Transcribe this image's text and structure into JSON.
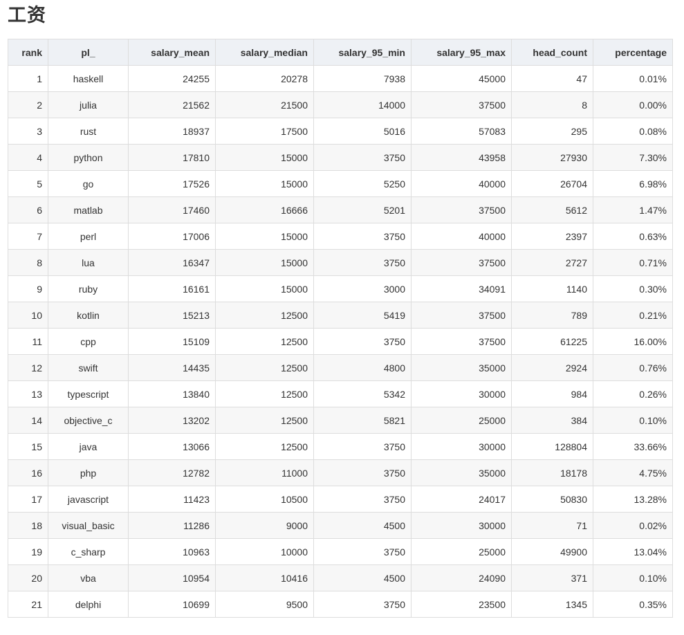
{
  "page": {
    "title": "工资"
  },
  "table": {
    "columns": [
      "rank",
      "pl_",
      "salary_mean",
      "salary_median",
      "salary_95_min",
      "salary_95_max",
      "head_count",
      "percentage"
    ],
    "rows": [
      [
        "1",
        "haskell",
        "24255",
        "20278",
        "7938",
        "45000",
        "47",
        "0.01%"
      ],
      [
        "2",
        "julia",
        "21562",
        "21500",
        "14000",
        "37500",
        "8",
        "0.00%"
      ],
      [
        "3",
        "rust",
        "18937",
        "17500",
        "5016",
        "57083",
        "295",
        "0.08%"
      ],
      [
        "4",
        "python",
        "17810",
        "15000",
        "3750",
        "43958",
        "27930",
        "7.30%"
      ],
      [
        "5",
        "go",
        "17526",
        "15000",
        "5250",
        "40000",
        "26704",
        "6.98%"
      ],
      [
        "6",
        "matlab",
        "17460",
        "16666",
        "5201",
        "37500",
        "5612",
        "1.47%"
      ],
      [
        "7",
        "perl",
        "17006",
        "15000",
        "3750",
        "40000",
        "2397",
        "0.63%"
      ],
      [
        "8",
        "lua",
        "16347",
        "15000",
        "3750",
        "37500",
        "2727",
        "0.71%"
      ],
      [
        "9",
        "ruby",
        "16161",
        "15000",
        "3000",
        "34091",
        "1140",
        "0.30%"
      ],
      [
        "10",
        "kotlin",
        "15213",
        "12500",
        "5419",
        "37500",
        "789",
        "0.21%"
      ],
      [
        "11",
        "cpp",
        "15109",
        "12500",
        "3750",
        "37500",
        "61225",
        "16.00%"
      ],
      [
        "12",
        "swift",
        "14435",
        "12500",
        "4800",
        "35000",
        "2924",
        "0.76%"
      ],
      [
        "13",
        "typescript",
        "13840",
        "12500",
        "5342",
        "30000",
        "984",
        "0.26%"
      ],
      [
        "14",
        "objective_c",
        "13202",
        "12500",
        "5821",
        "25000",
        "384",
        "0.10%"
      ],
      [
        "15",
        "java",
        "13066",
        "12500",
        "3750",
        "30000",
        "128804",
        "33.66%"
      ],
      [
        "16",
        "php",
        "12782",
        "11000",
        "3750",
        "35000",
        "18178",
        "4.75%"
      ],
      [
        "17",
        "javascript",
        "11423",
        "10500",
        "3750",
        "24017",
        "50830",
        "13.28%"
      ],
      [
        "18",
        "visual_basic",
        "11286",
        "9000",
        "4500",
        "30000",
        "71",
        "0.02%"
      ],
      [
        "19",
        "c_sharp",
        "10963",
        "10000",
        "3750",
        "25000",
        "49900",
        "13.04%"
      ],
      [
        "20",
        "vba",
        "10954",
        "10416",
        "4500",
        "24090",
        "371",
        "0.10%"
      ],
      [
        "21",
        "delphi",
        "10699",
        "9500",
        "3750",
        "23500",
        "1345",
        "0.35%"
      ]
    ]
  }
}
